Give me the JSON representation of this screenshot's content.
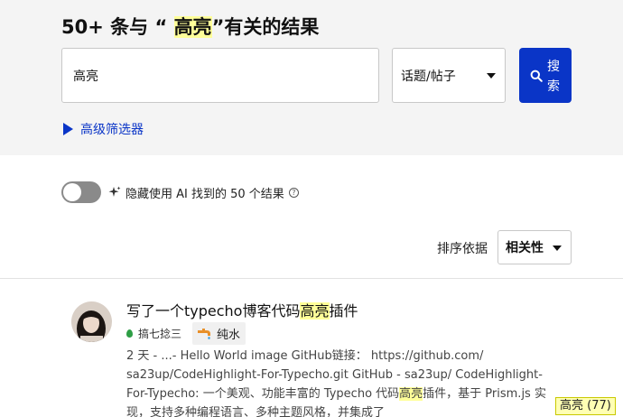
{
  "header": {
    "title_prefix": "50+ 条与 “ ",
    "title_keyword": "高亮",
    "title_suffix": "”有关的结果"
  },
  "search": {
    "value": "高亮",
    "scope_value": "话题/帖子",
    "button_label": "搜索"
  },
  "advanced": {
    "label": "高级筛选器"
  },
  "ai_toggle": {
    "label": "隐藏使用 AI 找到的 50 个结果",
    "enabled": false
  },
  "sort": {
    "label": "排序依据",
    "value": "相关性"
  },
  "results": [
    {
      "title_before": "写了一个typecho博客代码",
      "title_highlight": "高亮",
      "title_after": "插件",
      "category": "搞七捻三",
      "tag": "纯水",
      "excerpt_before": "2 天 - ...- Hello World image GitHub链接： https://github.com/ sa23up/CodeHighlight-For-Typecho.git GitHub - sa23up/ CodeHighlight-For-Typecho: 一个美观、功能丰富的 Typecho 代码",
      "excerpt_highlight": "高亮",
      "excerpt_after": "插件，基于 Prism.js 实现，支持多种编程语言、多种主题风格，并集成了"
    }
  ],
  "highlight_chip": "高亮 (77)",
  "colors": {
    "accent": "#0a35c7",
    "highlight": "#ffff99",
    "category": "#2e9e45",
    "tag_icon": "#e8902a"
  }
}
